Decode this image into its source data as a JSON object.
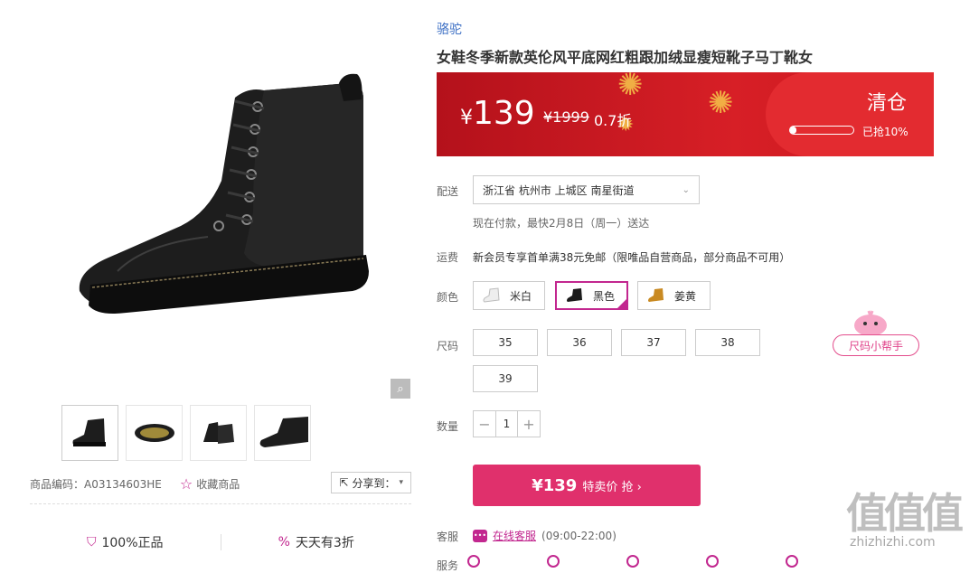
{
  "product": {
    "brand": "骆驼",
    "title": "女鞋冬季新款英伦风平底网红粗跟加绒显瘦短靴子马丁靴女",
    "code_label": "商品编码：A03134603HE",
    "favorite_label": "收藏商品",
    "share_label": "分享到："
  },
  "price": {
    "currency": "¥",
    "current": "139",
    "original": "¥1999",
    "discount": "0.7折",
    "banner_tag": "清仓",
    "sold_progress": 0.1,
    "sold_text": "已抢10%"
  },
  "delivery": {
    "label": "配送",
    "address": "浙江省 杭州市 上城区 南星街道",
    "note": "现在付款，最快2月8日（周一）送达"
  },
  "freight": {
    "label": "运费",
    "text": "新会员专享首单满38元免邮（限唯品自营商品，部分商品不可用）"
  },
  "colors": {
    "label": "颜色",
    "options": [
      {
        "name": "米白",
        "selected": false,
        "swatch": "#f2f2f2"
      },
      {
        "name": "黑色",
        "selected": true,
        "swatch": "#1b1b1b"
      },
      {
        "name": "姜黄",
        "selected": false,
        "swatch": "#c98a22"
      }
    ]
  },
  "sizes": {
    "label": "尺码",
    "options": [
      "35",
      "36",
      "37",
      "38",
      "39"
    ],
    "helper": "尺码小帮手"
  },
  "quantity": {
    "label": "数量",
    "value": "1",
    "minus": "−",
    "plus": "+"
  },
  "buy": {
    "price": "¥139",
    "text": "特卖价 抢 ›"
  },
  "service": {
    "label": "客服",
    "link": "在线客服",
    "hours": "(09:00-22:00)",
    "next_label": "服务"
  },
  "promises": [
    {
      "text": "100%正品",
      "icon": "shield-check-icon"
    },
    {
      "text": "天天有3折",
      "icon": "percent-icon"
    }
  ],
  "watermark": {
    "big": "值值值",
    "small": "zhizhizhi.com"
  }
}
